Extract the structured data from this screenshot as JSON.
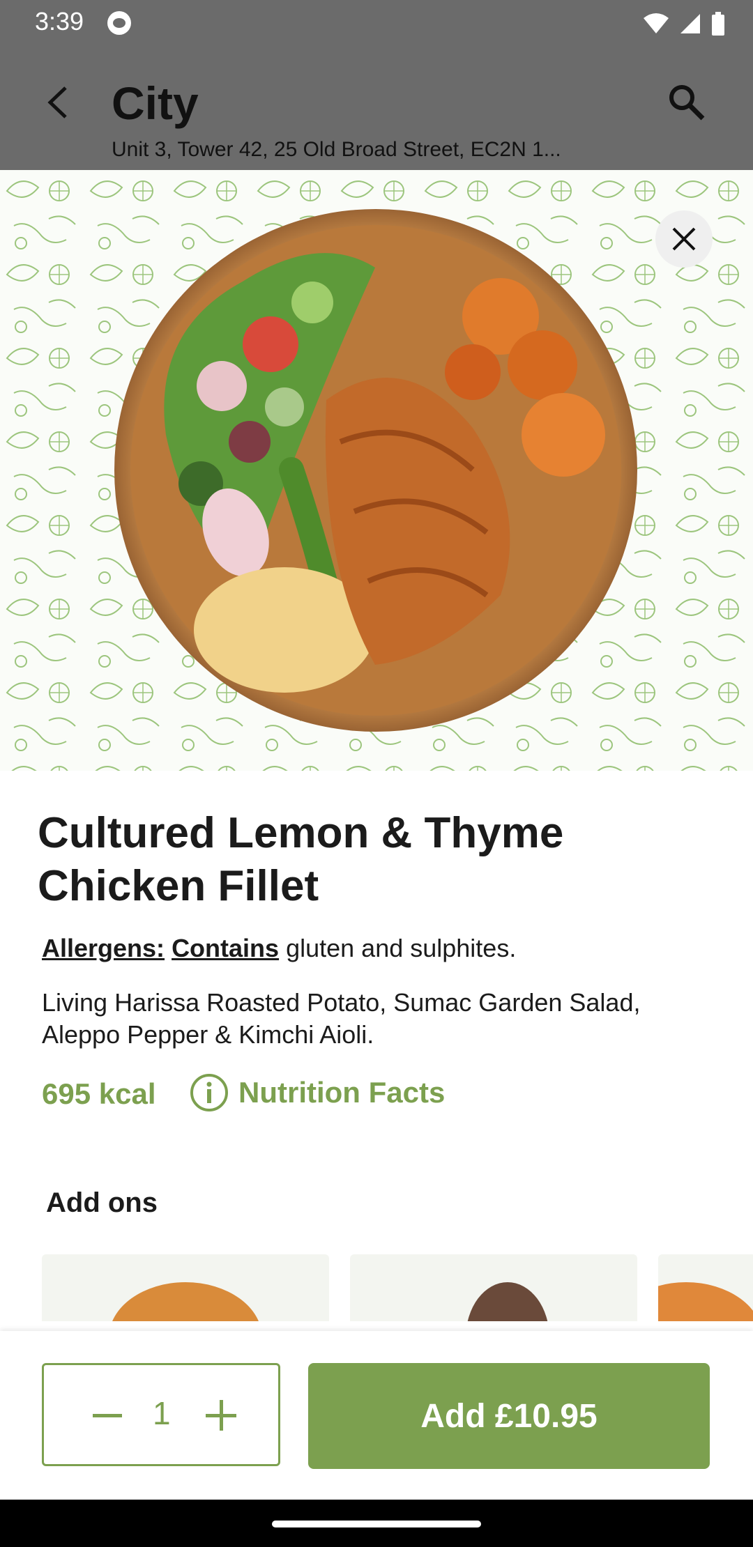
{
  "status_bar": {
    "time": "3:39"
  },
  "header": {
    "title": "City",
    "subtitle": "Unit 3, Tower 42, 25 Old Broad Street, EC2N 1..."
  },
  "product": {
    "name": "Cultured Lemon & Thyme Chicken Fillet",
    "allergens_label": "Allergens:",
    "allergens_contains": "Contains",
    "allergens_rest": "gluten and sulphites.",
    "description": "Living Harissa Roasted Potato, Sumac Garden Salad, Aleppo Pepper & Kimchi Aioli.",
    "kcal": "695 kcal",
    "nutrition_label": "Nutrition Facts"
  },
  "addons": {
    "heading": "Add ons"
  },
  "footer": {
    "quantity": "1",
    "add_label": "Add £10.95"
  },
  "colors": {
    "brand_green": "#7ca04f",
    "header_bg": "#6b6b6b"
  }
}
